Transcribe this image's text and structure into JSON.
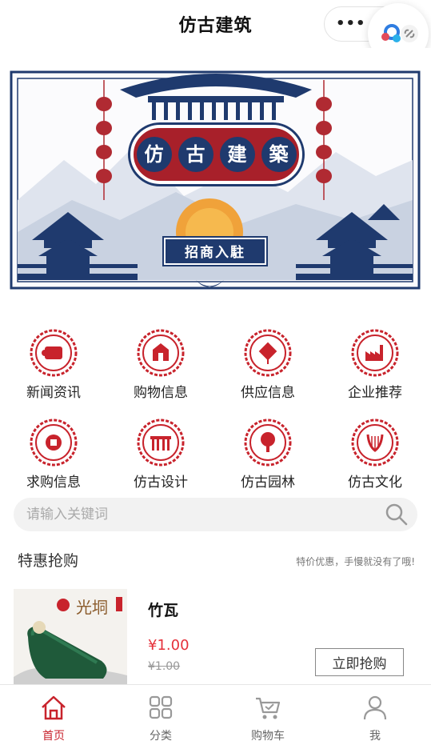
{
  "header": {
    "title": "仿古建筑"
  },
  "banner": {
    "title_chars": [
      "仿",
      "古",
      "建",
      "築"
    ],
    "subtitle": "招商入駐"
  },
  "categories": [
    {
      "label": "新闻资讯",
      "icon": "scroll-icon"
    },
    {
      "label": "购物信息",
      "icon": "shopping-bag-icon"
    },
    {
      "label": "供应信息",
      "icon": "chinese-knot-icon"
    },
    {
      "label": "企业推荐",
      "icon": "factory-icon"
    },
    {
      "label": "求购信息",
      "icon": "coin-icon"
    },
    {
      "label": "仿古设计",
      "icon": "gate-icon"
    },
    {
      "label": "仿古园林",
      "icon": "tree-icon"
    },
    {
      "label": "仿古文化",
      "icon": "lyre-icon"
    }
  ],
  "search": {
    "placeholder": "请输入关键词"
  },
  "deals": {
    "title": "特惠抢购",
    "tip": "特价优惠，手慢就没有了哦!",
    "product": {
      "name": "竹瓦",
      "price": "¥1.00",
      "original_price": "¥1.00",
      "buy_label": "立即抢购",
      "image_text": "光垌"
    }
  },
  "tabbar": [
    {
      "label": "首页",
      "icon": "home-icon",
      "active": true
    },
    {
      "label": "分类",
      "icon": "grid-icon",
      "active": false
    },
    {
      "label": "购物车",
      "icon": "cart-icon",
      "active": false
    },
    {
      "label": "我",
      "icon": "user-icon",
      "active": false
    }
  ],
  "colors": {
    "accent": "#c8232c",
    "navy": "#1f3a6e",
    "price": "#e5303a"
  }
}
